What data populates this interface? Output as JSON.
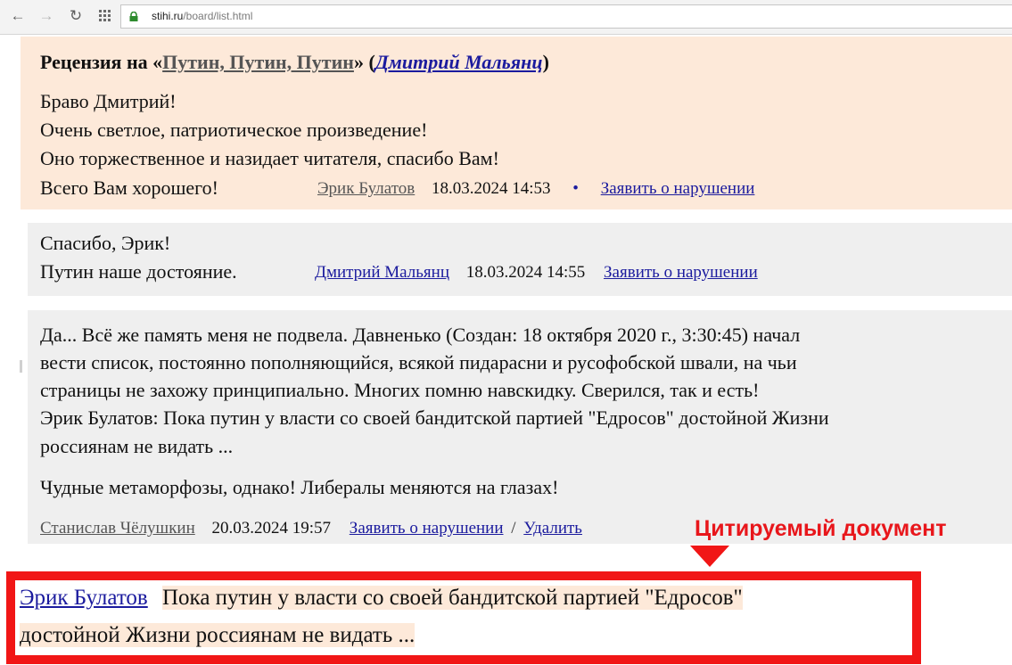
{
  "browser": {
    "url_host": "stihi.ru",
    "url_path": "/board/list.html"
  },
  "review": {
    "title_prefix": "Рецензия на «",
    "work_title": "Путин, Путин, Путин",
    "title_mid": "» (",
    "work_author": "Дмитрий Мальянц",
    "title_suffix": ")",
    "lines": [
      "Браво Дмитрий!",
      "Очень светлое, патриотическое произведение!",
      "Оно торжественное и назидает читателя, спасибо Вам!",
      "Всего Вам хорошего!"
    ],
    "user": "Эрик Булатов",
    "date": "18.03.2024 14:53",
    "separator": "•",
    "report_label": "Заявить о нарушении"
  },
  "reply": {
    "lines": [
      "Спасибо, Эрик!",
      "Путин наше достояние."
    ],
    "user": "Дмитрий Мальянц",
    "date": "18.03.2024 14:55",
    "report_label": "Заявить о нарушении"
  },
  "comment": {
    "lines": [
      "Да... Всё же память меня не подвела. Давненько (Создан: 18 октября 2020 г., 3:30:45) начал",
      "вести список, постоянно пополняющийся, всякой пидарасни и русофобской швали, на чьи",
      "страницы не захожу принципиально. Многих помню навскидку. Сверился, так и есть!",
      "Эрик Булатов: Пока путин у власти со своей бандитской партией \"Едросов\" достойной Жизни",
      "россиянам не видать ..."
    ],
    "closing": "Чудные метаморфозы, однако! Либералы меняются на глазах!",
    "user": "Станислав Чёлушкин",
    "date": "20.03.2024 19:57",
    "report_label": "Заявить о нарушении",
    "slash": "/",
    "delete_label": "Удалить"
  },
  "annotation": {
    "label": "Цитируемый документ",
    "accent_color": "#f11616",
    "quote_author": "Эрик Булатов",
    "quote_line1": "Пока путин у власти со своей бандитской партией \"Едросов\"",
    "quote_line2": "достойной Жизни россиянам не видать ..."
  }
}
